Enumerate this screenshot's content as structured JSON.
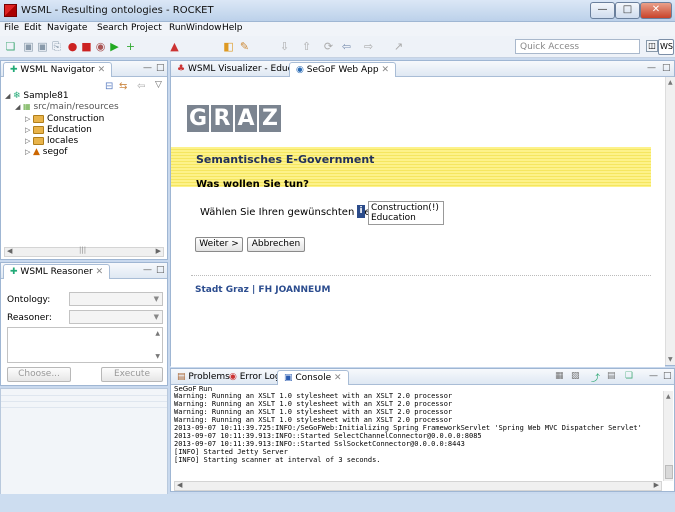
{
  "window": {
    "title": "WSML - Resulting ontologies - ROCKET"
  },
  "menu": [
    "File",
    "Edit",
    "Navigate",
    "Search",
    "Project",
    "Run",
    "Window",
    "Help"
  ],
  "toolbar": {
    "quick_access_placeholder": "Quick Access",
    "perspective": "WSML"
  },
  "navigator": {
    "tab": "WSML Navigator",
    "tree": [
      {
        "label": "Sample81",
        "level": 0,
        "expanded": true
      },
      {
        "label": "src/main/resources",
        "level": 1,
        "expanded": true
      },
      {
        "label": "Construction",
        "level": 2
      },
      {
        "label": "Education",
        "level": 2
      },
      {
        "label": "locales",
        "level": 2
      },
      {
        "label": "segof",
        "level": 2
      }
    ]
  },
  "reasoner": {
    "tab": "WSML Reasoner",
    "ontology_label": "Ontology:",
    "reasoner_label": "Reasoner:",
    "choose_button": "Choose...",
    "execute_button": "Execute"
  },
  "editor": {
    "tabs": [
      "WSML Visualizer - Education",
      "SeGoF Web App"
    ],
    "active_tab": 1,
    "web": {
      "logo_letters": [
        "G",
        "R",
        "A",
        "Z"
      ],
      "banner_title": "Semantisches E-Government",
      "question": "Was wollen Sie tun?",
      "select_label": "Wählen Sie Ihren gewünschten Bereich:",
      "options": [
        "Construction(!)",
        "Education"
      ],
      "next_button": "Weiter >",
      "cancel_button": "Abbrechen",
      "footer": "Stadt Graz | FH JOANNEUM"
    }
  },
  "console": {
    "tabs": [
      "Problems",
      "Error Log",
      "Console"
    ],
    "active_tab": 2,
    "run_label": "SeGoF Run",
    "lines": [
      "Warning: Running an XSLT 1.0 stylesheet with an XSLT 2.0 processor",
      "Warning: Running an XSLT 1.0 stylesheet with an XSLT 2.0 processor",
      "Warning: Running an XSLT 1.0 stylesheet with an XSLT 2.0 processor",
      "Warning: Running an XSLT 1.0 stylesheet with an XSLT 2.0 processor",
      "2013-09-07 10:11:39.725:INFO:/SeGoFWeb:Initializing Spring FrameworkServlet 'Spring Web MVC Dispatcher Servlet'",
      "2013-09-07 10:11:39.913:INFO::Started SelectChannelConnector@0.0.0.0:8085",
      "2013-09-07 10:11:39.913:INFO::Started SslSocketConnector@0.0.0.0:8443",
      "[INFO] Started Jetty Server",
      "[INFO] Starting scanner at interval of 3 seconds."
    ]
  }
}
